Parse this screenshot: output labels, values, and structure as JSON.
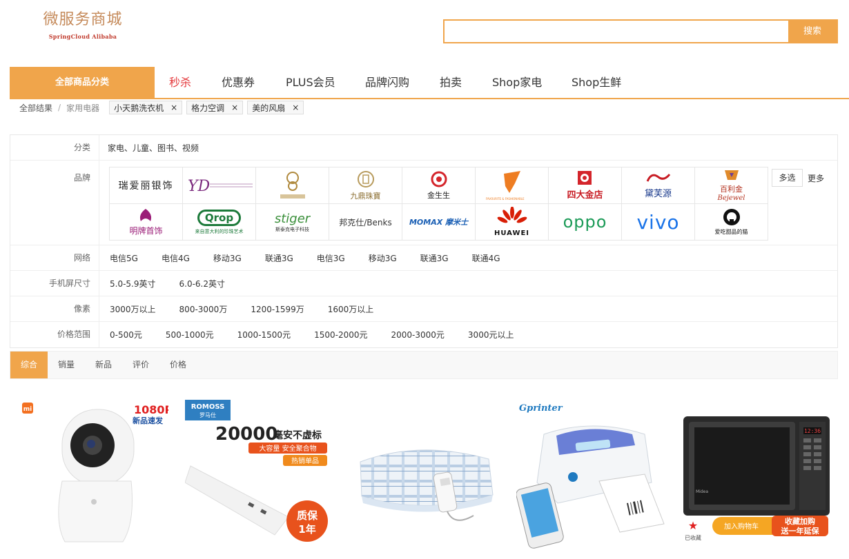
{
  "header": {
    "logo_title": "微服务商城",
    "logo_subtitle": "SpringCloud Alibaba",
    "search_placeholder": "",
    "search_button": "搜索"
  },
  "nav": {
    "all_categories": "全部商品分类",
    "links": [
      "秒杀",
      "优惠券",
      "PLUS会员",
      "品牌闪购",
      "拍卖",
      "Shop家电",
      "Shop生鲜"
    ]
  },
  "breadcrumb": {
    "root": "全部结果",
    "category": "家用电器",
    "tags": [
      "小天鹅洗衣机",
      "格力空调",
      "美的风扇"
    ],
    "close_glyph": "×"
  },
  "filters": {
    "category": {
      "label": "分类",
      "value": "家电、儿童、图书、视频"
    },
    "brand": {
      "label": "品牌",
      "multi_select": "多选",
      "more": "更多",
      "items": [
        "瑞爱丽银饰",
        "一得珠宝",
        "豐盛珠寶",
        "九鼎珠寶",
        "金生生",
        "FAVOURITE & FASHIONABLE",
        "四大金店",
        "黛芙源",
        "百利金",
        "明牌首饰",
        "Qrop",
        "stiger",
        "邦克仕/Benks",
        "MOMAX 摩米士",
        "HUAWEI",
        "oppo",
        "vivo",
        "爱吃甜品的猫"
      ]
    },
    "network": {
      "label": "网络",
      "values": [
        "电信5G",
        "电信4G",
        "移动3G",
        "联通3G",
        "电信3G",
        "移动3G",
        "联通3G",
        "联通4G"
      ]
    },
    "screen": {
      "label": "手机屏尺寸",
      "values": [
        "5.0-5.9英寸",
        "6.0-6.2英寸"
      ]
    },
    "pixel": {
      "label": "像素",
      "values": [
        "3000万以上",
        "800-3000万",
        "1200-1599万",
        "1600万以上"
      ]
    },
    "price": {
      "label": "价格范围",
      "values": [
        "0-500元",
        "500-1000元",
        "1000-1500元",
        "1500-2000元",
        "2000-3000元",
        "3000元以上"
      ]
    }
  },
  "sort": [
    "综合",
    "销量",
    "新品",
    "评价",
    "价格"
  ],
  "products": {
    "p1": {
      "badge": "1080P",
      "sub": "新品速发",
      "brand": "mi"
    },
    "p2": {
      "brand": "ROMOSS",
      "brand_cn": "罗马仕",
      "headline": "20000",
      "headline_suffix": "毫安不虚标",
      "line1": "大容量 安全聚合物",
      "line2": "热销单品",
      "stamp1": "质保",
      "stamp2": "1年"
    },
    "p3": {},
    "p4": {
      "brand": "Gprinter"
    },
    "p5": {
      "clock": "12:36",
      "brand": "Midea",
      "fav": "已收藏",
      "cart": "加入购物车",
      "promo1": "收藏加购",
      "promo2": "送一年延保"
    }
  }
}
